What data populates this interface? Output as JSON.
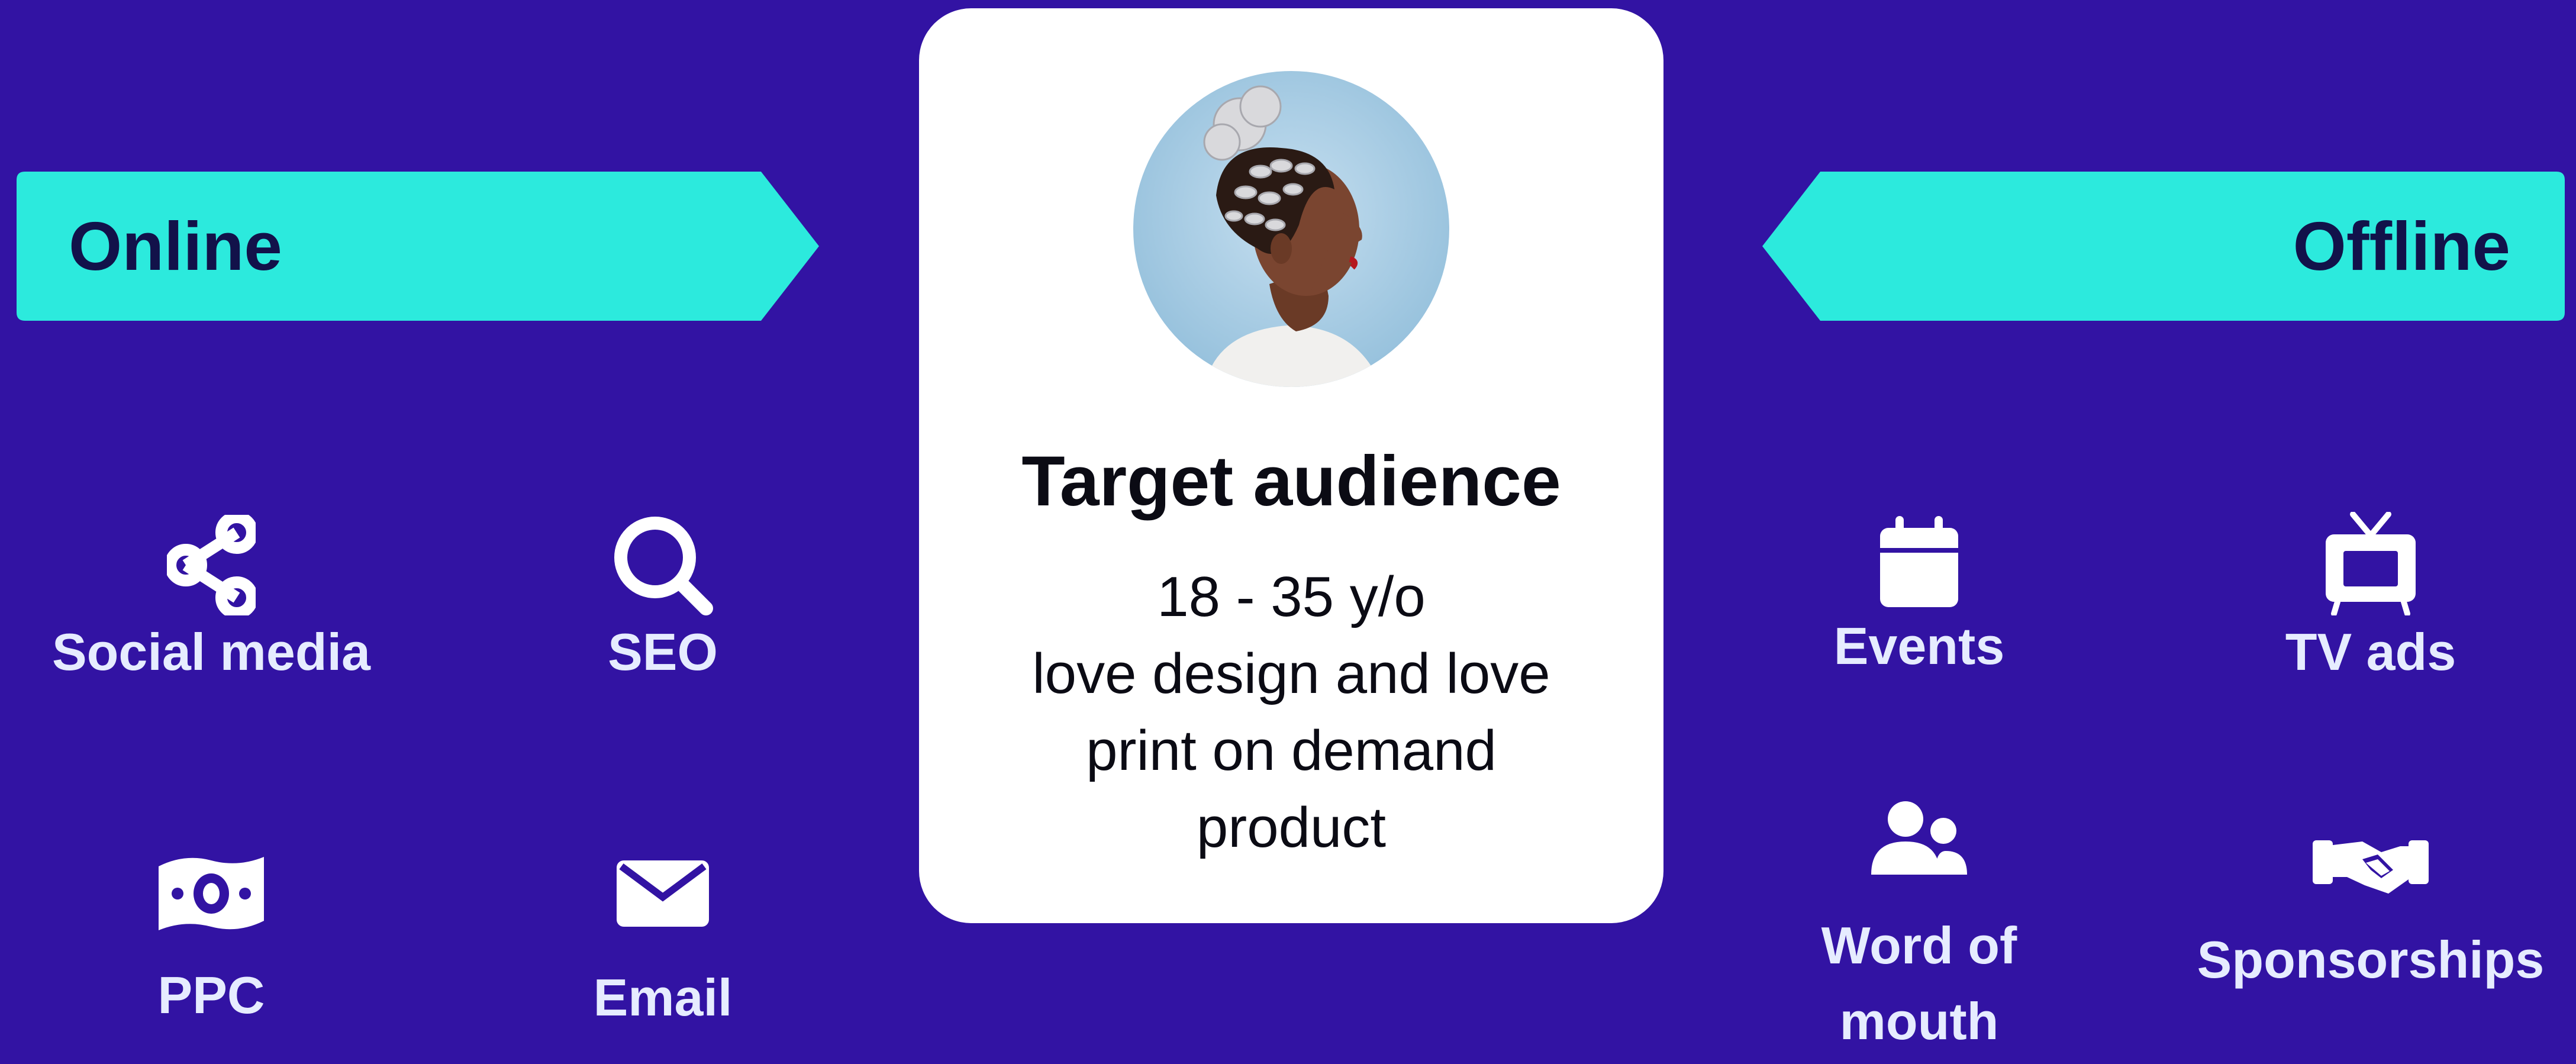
{
  "colors": {
    "background": "#3213a3",
    "banner": "#2ceadd",
    "banner_text": "#12124a",
    "item_text": "#e6ecff",
    "card": "#ffffff"
  },
  "online": {
    "label": "Online",
    "items": [
      {
        "label": "Social media",
        "icon": "share-icon"
      },
      {
        "label": "SEO",
        "icon": "search-icon"
      },
      {
        "label": "PPC",
        "icon": "money-icon"
      },
      {
        "label": "Email",
        "icon": "envelope-icon"
      }
    ]
  },
  "offline": {
    "label": "Offline",
    "items": [
      {
        "label": "Events",
        "icon": "calendar-icon"
      },
      {
        "label": "TV ads",
        "icon": "tv-icon"
      },
      {
        "label_lines": [
          "Word of",
          "mouth"
        ],
        "icon": "users-icon"
      },
      {
        "label": "Sponsorships",
        "icon": "handshake-icon"
      }
    ]
  },
  "card": {
    "title": "Target audience",
    "lines": [
      "18 - 35 y/o",
      "love design and love",
      "print on demand",
      "product"
    ],
    "avatar": "portrait-photo"
  }
}
